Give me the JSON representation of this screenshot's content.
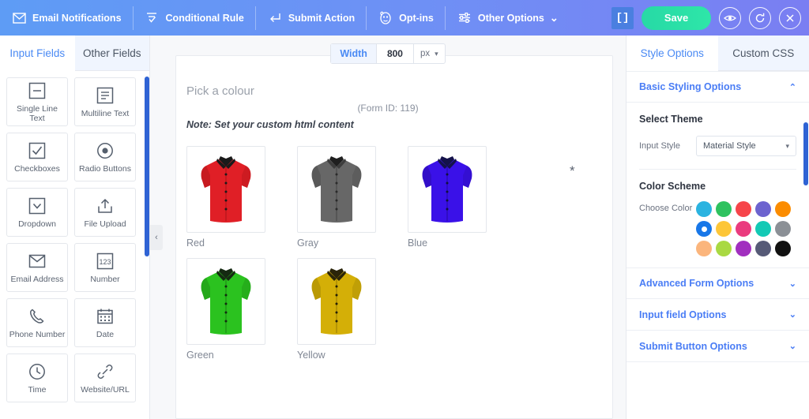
{
  "topbar": {
    "items": [
      {
        "label": "Email Notifications",
        "icon": "envelope-icon"
      },
      {
        "label": "Conditional Rule",
        "icon": "conditional-rule-icon"
      },
      {
        "label": "Submit Action",
        "icon": "submit-action-icon"
      },
      {
        "label": "Opt-ins",
        "icon": "optins-monkey-icon"
      },
      {
        "label": "Other Options",
        "icon": "sliders-icon",
        "caret": "⌄"
      }
    ],
    "code_button": "[]",
    "save_label": "Save",
    "actions": [
      {
        "name": "preview-icon",
        "glyph": "eye"
      },
      {
        "name": "refresh-icon",
        "glyph": "refresh"
      },
      {
        "name": "close-icon",
        "glyph": "close"
      }
    ],
    "accent_gradient_from": "#5e9cf5",
    "accent_gradient_to": "#7a7ef2",
    "save_color": "#2ee6a8"
  },
  "left_panel": {
    "tabs": [
      {
        "label": "Input Fields",
        "active": true
      },
      {
        "label": "Other Fields",
        "active": false
      }
    ],
    "fields": [
      {
        "label": "Single Line Text",
        "icon": "single-line-text-icon"
      },
      {
        "label": "Multiline Text",
        "icon": "multiline-text-icon"
      },
      {
        "label": "Checkboxes",
        "icon": "checkbox-icon"
      },
      {
        "label": "Radio Buttons",
        "icon": "radio-button-icon"
      },
      {
        "label": "Dropdown",
        "icon": "dropdown-icon"
      },
      {
        "label": "File Upload",
        "icon": "file-upload-icon"
      },
      {
        "label": "Email Address",
        "icon": "email-icon"
      },
      {
        "label": "Number",
        "icon": "number-icon"
      },
      {
        "label": "Phone Number",
        "icon": "phone-icon"
      },
      {
        "label": "Date",
        "icon": "calendar-icon"
      },
      {
        "label": "Time",
        "icon": "clock-icon"
      },
      {
        "label": "Website/URL",
        "icon": "link-icon"
      }
    ],
    "collapse_chevron": "‹"
  },
  "canvas": {
    "width_label": "Width",
    "width_value": "800",
    "width_unit": "px",
    "unit_caret": "▾",
    "form_id": "(Form ID: 119)",
    "form_title": "Pick a colour",
    "note": "Note: Set your custom html content",
    "required_marker": "*",
    "options": [
      {
        "label": "Red",
        "color": "#e01f26",
        "shade": "#a8141a"
      },
      {
        "label": "Gray",
        "color": "#676767",
        "shade": "#4a4a4a"
      },
      {
        "label": "Blue",
        "color": "#3a11e8",
        "shade": "#2a0ba8"
      },
      {
        "label": "Green",
        "color": "#2bc21f",
        "shade": "#1d8a15"
      },
      {
        "label": "Yellow",
        "color": "#d4af07",
        "shade": "#9c8005"
      }
    ]
  },
  "right_panel": {
    "tabs": [
      {
        "label": "Style Options",
        "active": true
      },
      {
        "label": "Custom CSS",
        "active": false
      }
    ],
    "sections": [
      {
        "label": "Basic Styling Options",
        "expanded": true,
        "chevron": "⌃"
      },
      {
        "label": "Advanced Form Options",
        "expanded": false,
        "chevron": "⌄"
      },
      {
        "label": "Input field Options",
        "expanded": false,
        "chevron": "⌄"
      },
      {
        "label": "Submit Button Options",
        "expanded": false,
        "chevron": "⌄"
      }
    ],
    "select_theme_title": "Select Theme",
    "input_style_label": "Input Style",
    "input_style_value": "Material Style",
    "select_caret": "▾",
    "color_scheme_title": "Color Scheme",
    "choose_color_label": "Choose Color",
    "colors": [
      {
        "hex": "#2bb3e0",
        "selected": false
      },
      {
        "hex": "#2ec25f",
        "selected": false
      },
      {
        "hex": "#f6454a",
        "selected": false
      },
      {
        "hex": "#6c63cf",
        "selected": false
      },
      {
        "hex": "#fb8c00",
        "selected": false
      },
      {
        "hex": "#1877e8",
        "selected": true
      },
      {
        "hex": "#fdc638",
        "selected": false
      },
      {
        "hex": "#ea3b7e",
        "selected": false
      },
      {
        "hex": "#13c9b5",
        "selected": false
      },
      {
        "hex": "#8b9096",
        "selected": false
      },
      {
        "hex": "#fbb57c",
        "selected": false
      },
      {
        "hex": "#a9d942",
        "selected": false
      },
      {
        "hex": "#a12fbf",
        "selected": false
      },
      {
        "hex": "#565a77",
        "selected": false
      },
      {
        "hex": "#111111",
        "selected": false
      }
    ]
  }
}
